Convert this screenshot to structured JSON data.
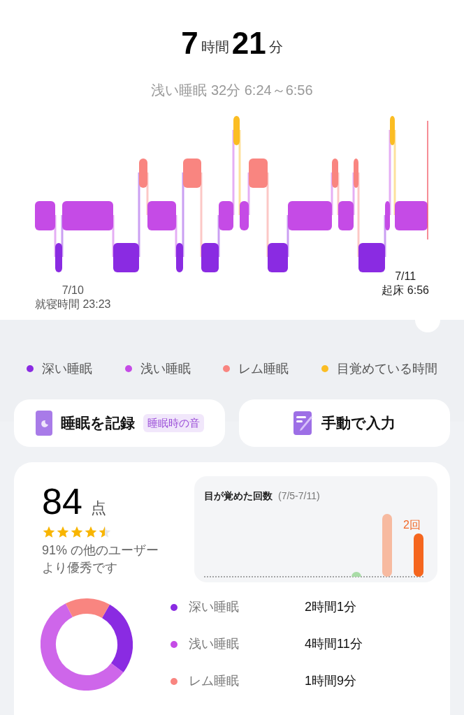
{
  "summary": {
    "hours": "7",
    "hours_unit": "時間",
    "minutes": "21",
    "minutes_unit": "分",
    "selection": "浅い睡眠 32分 6:24～6:56"
  },
  "hypnogram": {
    "start_date": "7/10",
    "start_label": "就寝時間 23:23",
    "end_date": "7/11",
    "end_label": "起床 6:56"
  },
  "legend": [
    {
      "label": "深い睡眠",
      "color": "#8a2be2"
    },
    {
      "label": "浅い睡眠",
      "color": "#c54be6"
    },
    {
      "label": "レム睡眠",
      "color": "#f98580"
    },
    {
      "label": "目覚めている時間",
      "color": "#fbbd23"
    }
  ],
  "actions": [
    {
      "kind": "record",
      "label": "睡眠を記録",
      "badge": "睡眠時の音"
    },
    {
      "kind": "manual",
      "label": "手動で入力"
    }
  ],
  "score": {
    "value": "84",
    "unit": "点",
    "stars": 4.5,
    "note": "91% の他のユーザーより優秀です"
  },
  "awakenings": {
    "title": "目が覚めた回数",
    "range": "(7/5-7/11)",
    "value_label": "2回"
  },
  "breakdown": [
    {
      "label": "深い睡眠",
      "value": "2時間1分",
      "color": "#8a2be2"
    },
    {
      "label": "浅い睡眠",
      "value": "4時間11分",
      "color": "#c54be6"
    },
    {
      "label": "レム睡眠",
      "value": "1時間9分",
      "color": "#f98580"
    }
  ]
}
